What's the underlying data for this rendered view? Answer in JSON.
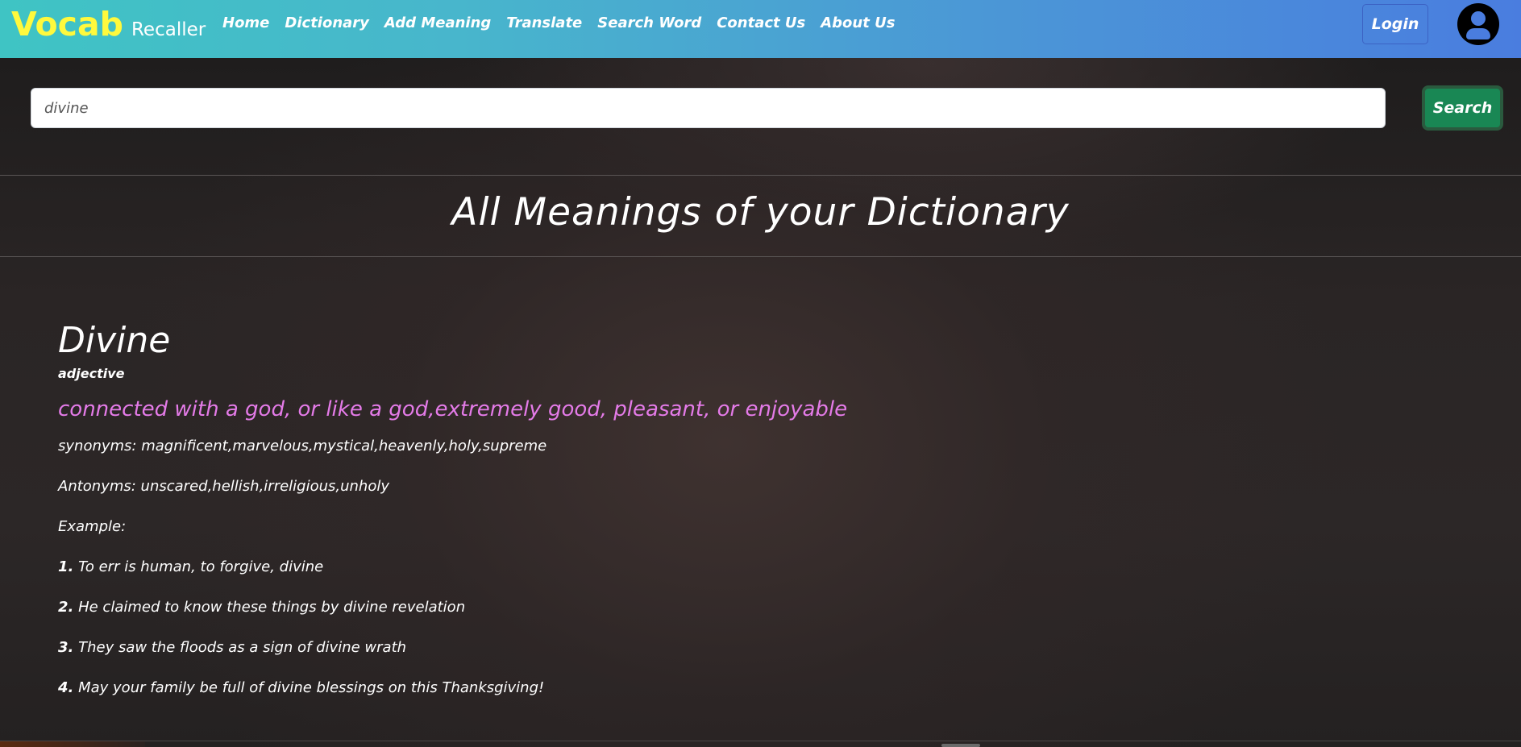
{
  "brand": {
    "main": "Vocab",
    "sub": "Recaller"
  },
  "nav": {
    "items": [
      {
        "label": "Home"
      },
      {
        "label": "Dictionary"
      },
      {
        "label": "Add Meaning"
      },
      {
        "label": "Translate"
      },
      {
        "label": "Search Word"
      },
      {
        "label": "Contact Us"
      },
      {
        "label": "About Us"
      }
    ],
    "login_label": "Login",
    "avatar_icon": "user-circle-icon"
  },
  "search": {
    "value": "divine",
    "placeholder": "",
    "button_label": "Search"
  },
  "page": {
    "title": "All Meanings of your Dictionary"
  },
  "entry": {
    "word": "Divine",
    "part_of_speech": "adjective",
    "definition": "connected with a god, or like a god,extremely good, pleasant, or enjoyable",
    "synonyms": "synonyms: magnificent,marvelous,mystical,heavenly,holy,supreme",
    "antonyms": "Antonyms: unscared,hellish,irreligious,unholy",
    "example_label": "Example:",
    "examples": [
      {
        "num": "1.",
        "text": " To err is human, to forgive, divine"
      },
      {
        "num": "2.",
        "text": " He claimed to know these things by divine revelation"
      },
      {
        "num": "3.",
        "text": " They saw the floods as a sign of divine wrath"
      },
      {
        "num": "4.",
        "text": " May your family be full of divine blessings on this Thanksgiving!"
      }
    ]
  },
  "colors": {
    "brand_main": "#fff93d",
    "definition": "#e47be8",
    "search_button": "#198754",
    "navbar_start": "#3fc4c4",
    "navbar_end": "#4a7ddf"
  }
}
